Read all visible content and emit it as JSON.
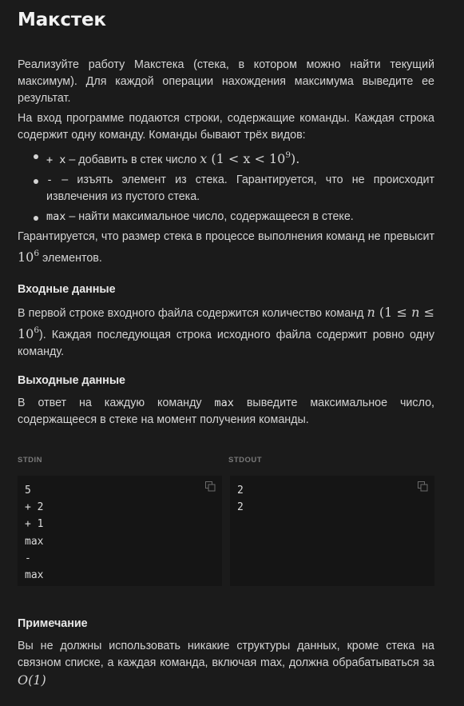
{
  "title": "Макстек",
  "intro": "Реализуйте работу Макстека (стека, в котором можно найти текущий максимум). Для каждой операции нахождения максимума выведите ее результат.",
  "input_desc": "На вход программе подаются строки, содержащие команды. Каждая строка содержит одну команду. Команды бывают трёх видов:",
  "commands": [
    {
      "code": "+ x",
      "text_a": " – добавить в стек число ",
      "math": "x",
      "text_b": " (1 < x < 10",
      "sup": "9",
      "text_c": ")."
    },
    {
      "code": "-",
      "text": " – изъять элемент из стека. Гарантируется, что не происходит извлечения из пустого стека."
    },
    {
      "code": "max",
      "text": " – найти максимальное число, содержащееся в стеке."
    }
  ],
  "guarantee_a": "Гарантируется, что размер стека в процессе выполнения команд не превысит ",
  "guarantee_math": "10",
  "guarantee_sup": "6",
  "guarantee_b": " элементов.",
  "input_heading": "Входные данные",
  "input_text_a": "В первой строке входного файла содержится количество команд ",
  "input_n": "n",
  "input_range_a": " (1 ≤ ",
  "input_range_b": " ≤ 10",
  "input_sup": "6",
  "input_text_b": "). Каждая последующая строка исходного файла содержит ровно одну команду.",
  "output_heading": "Выходные данные",
  "output_text_a": "В ответ на каждую команду ",
  "output_code": "max",
  "output_text_b": " выведите максимальное число, содержащееся в стеке на момент получения команды.",
  "stdin_label": "STDIN",
  "stdout_label": "STDOUT",
  "stdin_lines": [
    "5",
    "+ 2",
    "+ 1",
    "max",
    "-",
    "max"
  ],
  "stdout_lines": [
    "2",
    "2"
  ],
  "note_heading": "Примечание",
  "note_text": "Вы не должны использовать никакие структуры данных, кроме стека на связном списке, а каждая команда, включая max, должна обрабатываться за ",
  "note_math": "O(1)",
  "icons": {
    "copy": "copy-icon"
  }
}
